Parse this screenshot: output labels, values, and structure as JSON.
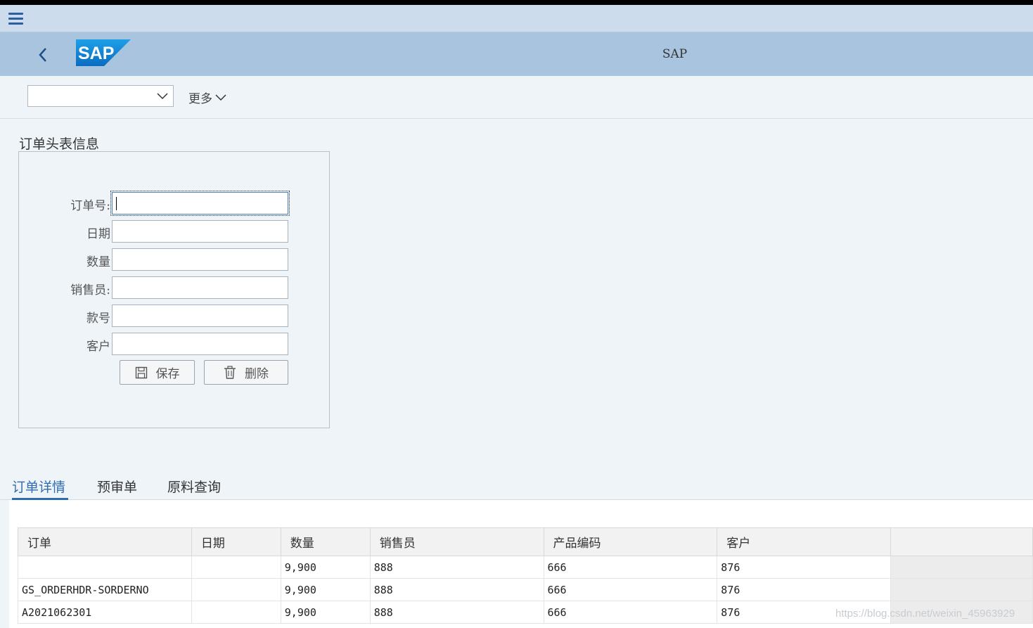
{
  "shell": {
    "title": "SAP",
    "logo_text": "SAP"
  },
  "toolbar": {
    "dropdown_value": "",
    "more_label": "更多"
  },
  "header_section": {
    "title": "订单头表信息",
    "fields": [
      {
        "label": "订单号:",
        "value": ""
      },
      {
        "label": "日期",
        "value": ""
      },
      {
        "label": "数量",
        "value": ""
      },
      {
        "label": "销售员:",
        "value": ""
      },
      {
        "label": "款号",
        "value": ""
      },
      {
        "label": "客户",
        "value": ""
      }
    ],
    "save_label": "保存",
    "delete_label": "删除"
  },
  "tabs": [
    {
      "label": "订单详情",
      "active": true
    },
    {
      "label": "预审单",
      "active": false
    },
    {
      "label": "原料查询",
      "active": false
    }
  ],
  "table": {
    "columns": [
      "订单",
      "日期",
      "数量",
      "销售员",
      "产品编码",
      "客户"
    ],
    "rows": [
      [
        "",
        "",
        "9,900",
        "888",
        "666",
        "876"
      ],
      [
        "GS_ORDERHDR-SORDERNO",
        "",
        "9,900",
        "888",
        "666",
        "876"
      ],
      [
        "A2021062301",
        "",
        "9,900",
        "888",
        "666",
        "876"
      ]
    ]
  },
  "watermark": "https://blog.csdn.net/weixin_45963929",
  "colors": {
    "shell_bg": "#a8c4df",
    "accent": "#2f6bb0",
    "sap_blue": "#1a8ad4"
  }
}
